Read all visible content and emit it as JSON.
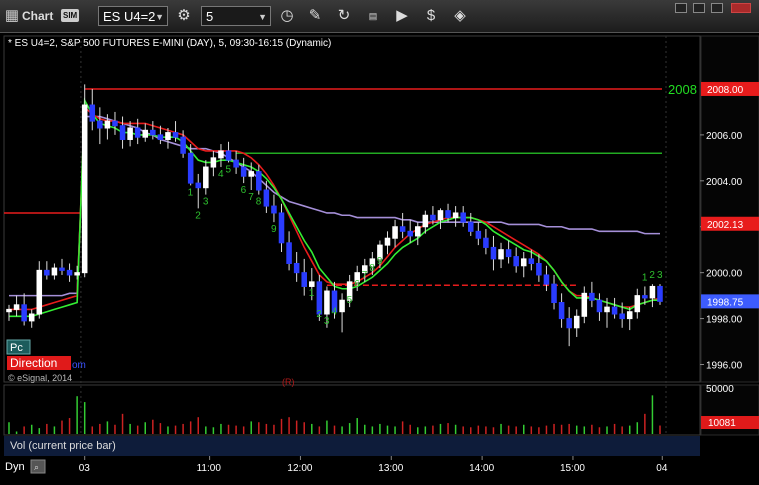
{
  "toolbar": {
    "title": "Chart",
    "sim_badge": "SIM",
    "symbol": "ES U4=2",
    "interval": "5"
  },
  "chart_header": {
    "description": "* ES U4=2, S&P 500 FUTURES E-MINI (DAY), 5, 09:30-16:15 (Dynamic)",
    "watermark": "© eSignal, 2014",
    "pc_label": "Pc",
    "direction_label": "Direction",
    "direction_suffix": "om",
    "red_marker": "(R)"
  },
  "volume_pane": {
    "label": "Vol (current price bar)",
    "max_tick": "50000",
    "current_value": "10081"
  },
  "footer": {
    "dyn_label": "Dyn"
  },
  "chart_data": {
    "type": "candlestick",
    "yaxis": {
      "ticks": [
        "2006.00",
        "2004.00",
        "2002.00",
        "2000.00",
        "1998.00",
        "1996.00"
      ],
      "ylim": [
        1995.5,
        2009.0
      ]
    },
    "xaxis": {
      "ticks": [
        "03",
        "11:00",
        "12:00",
        "13:00",
        "14:00",
        "15:00",
        "04"
      ]
    },
    "price_labels": {
      "high_level": {
        "value": "2008.00",
        "color": "#e81c1c"
      },
      "mid_level": {
        "value": "2002.13",
        "color": "#e81c1c"
      },
      "last_price": {
        "value": "1998.75",
        "color": "#3d5cff"
      }
    },
    "level_annotation": {
      "text": "2008",
      "color": "#22dd22"
    },
    "horizontal_levels": [
      {
        "name": "prior-day-high",
        "value": 2008.0,
        "color": "#e81c1c",
        "style": "solid"
      },
      {
        "name": "green-level",
        "value": 2005.2,
        "color": "#22aa22",
        "style": "solid"
      },
      {
        "name": "red-dashed-level",
        "value": 1999.45,
        "color": "#e81c1c",
        "style": "dashed"
      }
    ],
    "sequence_labels": [
      "1",
      "2",
      "3",
      "4",
      "5",
      "6",
      "7",
      "8",
      "9",
      "1",
      "2",
      "3",
      "4",
      "5",
      "6",
      "7",
      "8",
      "9",
      "1",
      "2",
      "3"
    ],
    "colors": {
      "up": "#ffffff",
      "down": "#2a3cff",
      "ema_green": "#33ee33",
      "vwap_red": "#e81c1c",
      "avg_purple": "#a58fd8",
      "seq": "#2ec02e",
      "volume_up": "#33cc33",
      "volume_down": "#cc2222"
    },
    "candles": [
      [
        1998.3,
        1998.6,
        1997.9,
        1998.4
      ],
      [
        1998.4,
        1999.0,
        1998.1,
        1998.6
      ],
      [
        1998.6,
        1999.1,
        1997.7,
        1997.9
      ],
      [
        1997.9,
        1998.4,
        1997.6,
        1998.2
      ],
      [
        1998.2,
        2000.5,
        1998.0,
        2000.1
      ],
      [
        2000.1,
        2000.5,
        1999.7,
        1999.9
      ],
      [
        1999.9,
        2000.4,
        1999.7,
        2000.2
      ],
      [
        2000.2,
        2000.6,
        1999.9,
        2000.1
      ],
      [
        2000.1,
        2000.4,
        1999.6,
        1999.9
      ],
      [
        1999.9,
        2000.3,
        1999.7,
        2000.0
      ],
      [
        2000.0,
        2008.2,
        1999.8,
        2007.3
      ],
      [
        2007.3,
        2008.0,
        2006.2,
        2006.6
      ],
      [
        2006.6,
        2007.2,
        2005.6,
        2006.3
      ],
      [
        2006.3,
        2006.9,
        2005.8,
        2006.6
      ],
      [
        2006.6,
        2007.0,
        2006.0,
        2006.4
      ],
      [
        2006.4,
        2006.8,
        2005.4,
        2005.8
      ],
      [
        2005.8,
        2006.6,
        2005.5,
        2006.3
      ],
      [
        2006.3,
        2006.7,
        2005.6,
        2005.9
      ],
      [
        2005.9,
        2006.5,
        2005.7,
        2006.2
      ],
      [
        2006.2,
        2006.6,
        2005.8,
        2006.0
      ],
      [
        2006.0,
        2006.4,
        2005.6,
        2005.8
      ],
      [
        2005.8,
        2006.3,
        2005.4,
        2006.1
      ],
      [
        2006.1,
        2006.6,
        2005.7,
        2005.9
      ],
      [
        2005.9,
        2006.2,
        2005.0,
        2005.2
      ],
      [
        2005.2,
        2005.6,
        2003.8,
        2003.9
      ],
      [
        2003.9,
        2004.3,
        2002.8,
        2003.7
      ],
      [
        2003.7,
        2004.9,
        2003.4,
        2004.6
      ],
      [
        2004.6,
        2005.3,
        2004.2,
        2005.0
      ],
      [
        2005.0,
        2005.6,
        2004.6,
        2005.3
      ],
      [
        2005.3,
        2005.7,
        2004.8,
        2004.9
      ],
      [
        2004.9,
        2005.3,
        2004.3,
        2004.6
      ],
      [
        2004.6,
        2005.0,
        2003.9,
        2004.2
      ],
      [
        2004.2,
        2004.8,
        2003.6,
        2004.4
      ],
      [
        2004.4,
        2004.7,
        2003.4,
        2003.6
      ],
      [
        2003.6,
        2004.0,
        2002.6,
        2002.9
      ],
      [
        2002.9,
        2003.4,
        2002.2,
        2002.6
      ],
      [
        2002.6,
        2003.0,
        2000.9,
        2001.3
      ],
      [
        2001.3,
        2001.8,
        2000.1,
        2000.4
      ],
      [
        2000.4,
        2000.9,
        1999.6,
        2000.0
      ],
      [
        2000.0,
        2000.6,
        1999.0,
        1999.4
      ],
      [
        1999.4,
        2000.2,
        1998.8,
        1999.6
      ],
      [
        1999.6,
        1999.9,
        1997.9,
        1998.2
      ],
      [
        1998.2,
        1999.4,
        1997.6,
        1999.2
      ],
      [
        1999.2,
        1999.6,
        1998.0,
        1998.3
      ],
      [
        1998.3,
        1999.1,
        1997.4,
        1998.8
      ],
      [
        1998.8,
        1999.9,
        1998.5,
        1999.6
      ],
      [
        1999.6,
        2000.3,
        1999.2,
        2000.0
      ],
      [
        2000.0,
        2000.6,
        1999.6,
        2000.3
      ],
      [
        2000.3,
        2000.9,
        1999.9,
        2000.6
      ],
      [
        2000.6,
        2001.4,
        2000.2,
        2001.2
      ],
      [
        2001.2,
        2001.8,
        2000.8,
        2001.5
      ],
      [
        2001.5,
        2002.3,
        2001.1,
        2002.0
      ],
      [
        2002.0,
        2002.6,
        2001.5,
        2001.8
      ],
      [
        2001.8,
        2002.3,
        2001.3,
        2001.6
      ],
      [
        2001.6,
        2002.2,
        2001.2,
        2002.0
      ],
      [
        2002.0,
        2002.7,
        2001.7,
        2002.5
      ],
      [
        2002.5,
        2002.9,
        2002.1,
        2002.3
      ],
      [
        2002.3,
        2002.8,
        2001.9,
        2002.7
      ],
      [
        2002.7,
        2003.0,
        2002.2,
        2002.4
      ],
      [
        2002.4,
        2002.9,
        2002.0,
        2002.6
      ],
      [
        2002.6,
        2002.9,
        2002.0,
        2002.2
      ],
      [
        2002.2,
        2002.6,
        2001.6,
        2001.8
      ],
      [
        2001.8,
        2002.2,
        2001.2,
        2001.5
      ],
      [
        2001.5,
        2001.9,
        2000.8,
        2001.1
      ],
      [
        2001.1,
        2001.6,
        2000.1,
        2000.6
      ],
      [
        2000.6,
        2001.3,
        2000.2,
        2001.0
      ],
      [
        2001.0,
        2001.4,
        2000.4,
        2000.7
      ],
      [
        2000.7,
        2001.1,
        2000.0,
        2000.3
      ],
      [
        2000.3,
        2000.9,
        1999.8,
        2000.6
      ],
      [
        2000.6,
        2001.0,
        2000.1,
        2000.4
      ],
      [
        2000.4,
        2000.8,
        1999.6,
        1999.9
      ],
      [
        1999.9,
        2000.3,
        1999.2,
        1999.5
      ],
      [
        1999.5,
        1999.9,
        1998.4,
        1998.7
      ],
      [
        1998.7,
        1999.1,
        1997.6,
        1998.0
      ],
      [
        1998.0,
        1998.5,
        1996.8,
        1997.6
      ],
      [
        1997.6,
        1998.4,
        1997.2,
        1998.1
      ],
      [
        1998.1,
        1999.4,
        1997.8,
        1999.1
      ],
      [
        1999.1,
        1999.6,
        1998.5,
        1998.8
      ],
      [
        1998.8,
        1999.1,
        1997.9,
        1998.3
      ],
      [
        1998.3,
        1998.9,
        1997.6,
        1998.5
      ],
      [
        1998.5,
        1998.9,
        1998.0,
        1998.2
      ],
      [
        1998.2,
        1998.7,
        1997.6,
        1998.0
      ],
      [
        1998.0,
        1998.5,
        1997.5,
        1998.3
      ],
      [
        1998.3,
        1999.3,
        1998.0,
        1999.0
      ],
      [
        1999.0,
        1999.4,
        1998.6,
        1998.9
      ],
      [
        1998.9,
        1999.5,
        1998.5,
        1999.4
      ],
      [
        1999.4,
        1999.5,
        1998.6,
        1998.75
      ]
    ],
    "ema_green": [
      1998.1,
      1998.1,
      1998.1,
      1998.1,
      1998.2,
      1998.3,
      1998.4,
      1998.5,
      1998.6,
      1998.7,
      2007.5,
      2006.9,
      2006.5,
      2006.4,
      2006.3,
      2006.1,
      2006.1,
      2006.0,
      2006.0,
      2006.0,
      2005.9,
      2005.9,
      2005.9,
      2005.7,
      2005.3,
      2004.9,
      2004.8,
      2004.8,
      2004.9,
      2004.9,
      2004.8,
      2004.7,
      2004.6,
      2004.4,
      2004.1,
      2003.7,
      2003.2,
      2002.6,
      2002.0,
      2001.4,
      2000.9,
      2000.2,
      1999.8,
      1999.4,
      1999.3,
      1999.3,
      1999.4,
      1999.6,
      1999.8,
      2000.1,
      2000.4,
      2000.8,
      2001.1,
      2001.3,
      2001.5,
      2001.8,
      2002.0,
      2002.2,
      2002.3,
      2002.4,
      2002.4,
      2002.4,
      2002.3,
      2002.1,
      2001.8,
      2001.6,
      2001.4,
      2001.2,
      2001.0,
      2000.9,
      2000.7,
      2000.5,
      2000.1,
      1999.6,
      1999.2,
      1998.9,
      1998.9,
      1998.9,
      1998.8,
      1998.7,
      1998.6,
      1998.5,
      1998.4,
      1998.6,
      1998.7,
      1998.8,
      1998.8
    ],
    "vwap_red": [
      1998.4,
      1998.4,
      1998.4,
      1998.4,
      1998.5,
      1998.6,
      1998.7,
      1998.8,
      1998.9,
      1999.0,
      2007.2,
      2006.9,
      2006.7,
      2006.6,
      2006.6,
      2006.5,
      2006.5,
      2006.5,
      2006.5,
      2006.4,
      2006.3,
      2006.2,
      2006.1,
      2006.0,
      2005.7,
      2005.4,
      2005.3,
      2005.3,
      2005.3,
      2005.3,
      2005.3,
      2005.2,
      2005.0,
      2004.7,
      2004.3,
      2003.8,
      2003.2,
      2002.5,
      2001.8,
      2001.1,
      2000.5,
      1999.9,
      1999.6,
      1999.5,
      1999.5,
      1999.5,
      1999.6,
      1999.8,
      2000.0,
      2000.3,
      2000.7,
      2001.1,
      2001.4,
      2001.7,
      2001.9,
      2002.1,
      2002.2,
      2002.3,
      2002.4,
      2002.4,
      2002.4,
      2002.4,
      2002.3,
      2002.2,
      2002.0,
      2001.8,
      2001.6,
      2001.4,
      2001.2,
      2001.0,
      2000.8,
      2000.5,
      2000.1,
      1999.6,
      1999.2,
      1999.0,
      1999.0,
      1998.9,
      1998.8,
      1998.7,
      1998.6,
      1998.5,
      1998.5,
      1998.6,
      1998.7,
      1998.8,
      1998.9
    ],
    "avg_purple": [
      1999.0,
      1999.0,
      1999.0,
      1999.0,
      1999.0,
      1999.0,
      1999.0,
      1999.0,
      1999.1,
      1999.1,
      2006.8,
      2006.8,
      2006.8,
      2006.7,
      2006.6,
      2006.5,
      2006.4,
      2006.3,
      2006.1,
      2006.0,
      2005.8,
      2005.7,
      2005.6,
      2005.5,
      2005.4,
      2005.4,
      2005.4,
      2005.3,
      2005.2,
      2005.0,
      2004.8,
      2004.6,
      2004.4,
      2004.1,
      2003.8,
      2003.5,
      2003.3,
      2003.1,
      2003.0,
      2002.9,
      2002.8,
      2002.7,
      2002.6,
      2002.6,
      2002.5,
      2002.5,
      2002.4,
      2002.4,
      2002.4,
      2002.4,
      2002.4,
      2002.4,
      2002.3,
      2002.3,
      2002.2,
      2002.2,
      2002.2,
      2002.2,
      2002.2,
      2002.2,
      2002.2,
      2002.2,
      2002.2,
      2002.2,
      2002.2,
      2002.2,
      2002.1,
      2002.1,
      2002.1,
      2002.1,
      2002.1,
      2002.0,
      2002.0,
      2002.0,
      2001.9,
      2001.9,
      2001.9,
      2001.9,
      2001.8,
      2001.8,
      2001.8,
      2001.8,
      2001.8,
      2001.8,
      2001.7,
      2001.7,
      2001.7
    ],
    "volume": [
      14000,
      3000,
      9000,
      11000,
      7000,
      12000,
      9000,
      16000,
      19000,
      45000,
      38000,
      9000,
      12000,
      15000,
      11000,
      24000,
      12000,
      10000,
      14000,
      17000,
      13000,
      9000,
      10000,
      12000,
      15000,
      20000,
      9000,
      8000,
      12000,
      11000,
      10000,
      9000,
      15000,
      14000,
      12000,
      11000,
      18000,
      20000,
      16000,
      14000,
      12000,
      9000,
      16000,
      10000,
      9000,
      13000,
      19000,
      11000,
      9000,
      12000,
      10000,
      9000,
      15000,
      11000,
      8000,
      9000,
      10000,
      12000,
      13000,
      11000,
      9000,
      8000,
      10000,
      9000,
      8000,
      12000,
      10000,
      9000,
      11000,
      9000,
      8000,
      10000,
      12000,
      11000,
      12000,
      10000,
      9000,
      11000,
      8000,
      9000,
      12000,
      9000,
      10000,
      14000,
      24000,
      46000,
      10081
    ]
  }
}
